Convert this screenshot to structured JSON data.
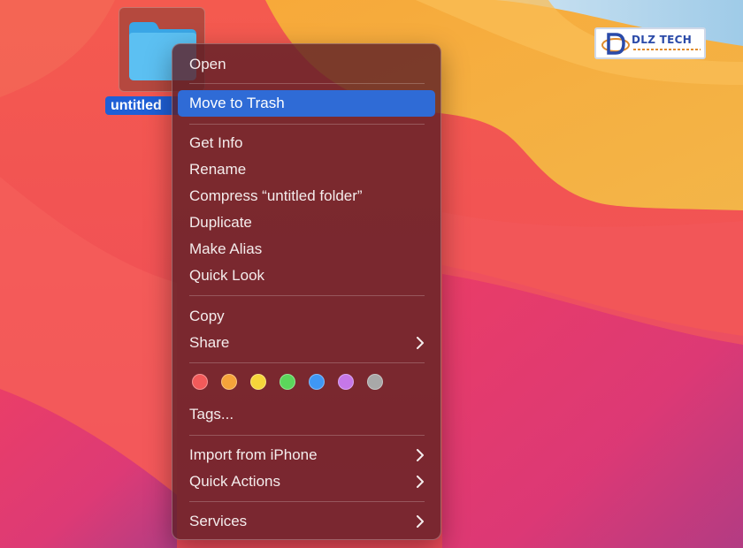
{
  "desktop": {
    "folder": {
      "label": "untitled"
    },
    "logo": {
      "brand_text": "DLZ TECH",
      "brand_color": "#2a4aa8",
      "accent_color": "#e08c2e"
    }
  },
  "context_menu": {
    "highlight_color": "#2f6bd6",
    "items": [
      {
        "label": "Open"
      },
      {
        "label": "Move to Trash",
        "highlighted": true
      },
      {
        "label": "Get Info"
      },
      {
        "label": "Rename"
      },
      {
        "label": "Compress “untitled folder”"
      },
      {
        "label": "Duplicate"
      },
      {
        "label": "Make Alias"
      },
      {
        "label": "Quick Look"
      },
      {
        "label": "Copy"
      },
      {
        "label": "Share",
        "submenu": true
      },
      {
        "label": "Tags..."
      },
      {
        "label": "Import from iPhone",
        "submenu": true
      },
      {
        "label": "Quick Actions",
        "submenu": true
      },
      {
        "label": "Services",
        "submenu": true
      }
    ],
    "tag_colors": [
      {
        "name": "red",
        "color": "#f25a5a"
      },
      {
        "name": "orange",
        "color": "#f5a33a"
      },
      {
        "name": "yellow",
        "color": "#f5d63a"
      },
      {
        "name": "green",
        "color": "#5bd65b"
      },
      {
        "name": "blue",
        "color": "#3f97f5"
      },
      {
        "name": "purple",
        "color": "#c677e8"
      },
      {
        "name": "gray",
        "color": "#a8a8a8"
      }
    ],
    "submenu_icon": "chevron-right-icon"
  }
}
